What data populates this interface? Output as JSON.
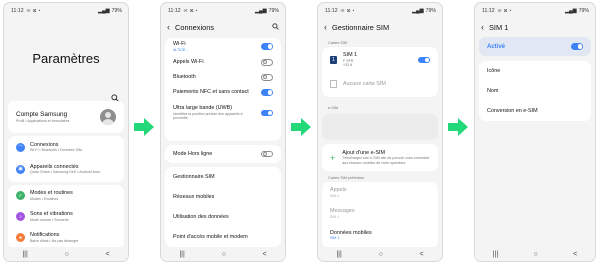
{
  "status": {
    "time": "11:12",
    "icons": "✉ ⊠ •",
    "battery": "79%"
  },
  "nav": {
    "recent": "|||",
    "home": "○",
    "back": "<"
  },
  "arrow_color": "#22d878",
  "accent": "#3e82f7",
  "s1": {
    "title": "Paramètres",
    "search_icon": "search-icon",
    "account": {
      "title": "Compte Samsung",
      "sub": "Profil • Applications et formulaires"
    },
    "items": [
      {
        "label": "Connexions",
        "sub": "Wi-Fi • Bluetooth • Données SIM",
        "color": "#3e82f7",
        "icon": "wifi-icon"
      },
      {
        "label": "Appareils connectés",
        "sub": "Quick Share • Samsung DeX • Android Auto",
        "color": "#3e82f7",
        "icon": "devices-icon"
      },
      {
        "label": "Modes et routines",
        "sub": "Modes • Routines",
        "color": "#3fb36a",
        "icon": "routines-icon"
      },
      {
        "label": "Sons et vibrations",
        "sub": "Mode sonore • Sonnerie",
        "color": "#a354e3",
        "icon": "sound-icon"
      },
      {
        "label": "Notifications",
        "sub": "Barre d'état • Ne pas déranger",
        "color": "#f27c3a",
        "icon": "bell-icon"
      }
    ]
  },
  "s2": {
    "title": "Connexions",
    "rows": [
      {
        "label": "Wi-Fi",
        "sub": "ALTICE...",
        "toggle": true
      },
      {
        "label": "Appels Wi-Fi",
        "toggle": false
      },
      {
        "label": "Bluetooth",
        "toggle": false
      },
      {
        "label": "Paiements NFC et sans contact",
        "toggle": true
      },
      {
        "label": "Ultra large bande (UWB)",
        "sub": "Identifiez la position précise des appareils à proximité.",
        "toggle": true
      }
    ],
    "airplane": "Mode Hors ligne",
    "links": [
      "Gestionnaire SIM",
      "Réseaux mobiles",
      "Utilisation des données",
      "Point d'accès mobile et modem"
    ]
  },
  "s3": {
    "title": "Gestionnaire SIM",
    "cards_label": "Cartes SIM",
    "sim1": {
      "badge": "1",
      "name": "SIM 1",
      "l1": "F SFR",
      "l2": "+33 6"
    },
    "no_sim": "Aucune carte SIM",
    "esim_label": "e-SIM",
    "add_esim": {
      "title": "Ajout d'une e-SIM",
      "sub": "Téléchargez une e-SIM afin de pouvoir vous connecter aux réseaux mobiles de votre opérateur."
    },
    "pref_label": "Cartes SIM préférées",
    "calls": {
      "label": "Appels",
      "value": "SIM 1"
    },
    "messages": {
      "label": "Messages",
      "value": "SIM 1"
    },
    "data": {
      "label": "Données mobiles",
      "value": "SIM 1"
    }
  },
  "s4": {
    "title": "SIM 1",
    "active": "Activé",
    "items": [
      "Icône",
      "Nom",
      "Conversion en e-SIM"
    ]
  }
}
